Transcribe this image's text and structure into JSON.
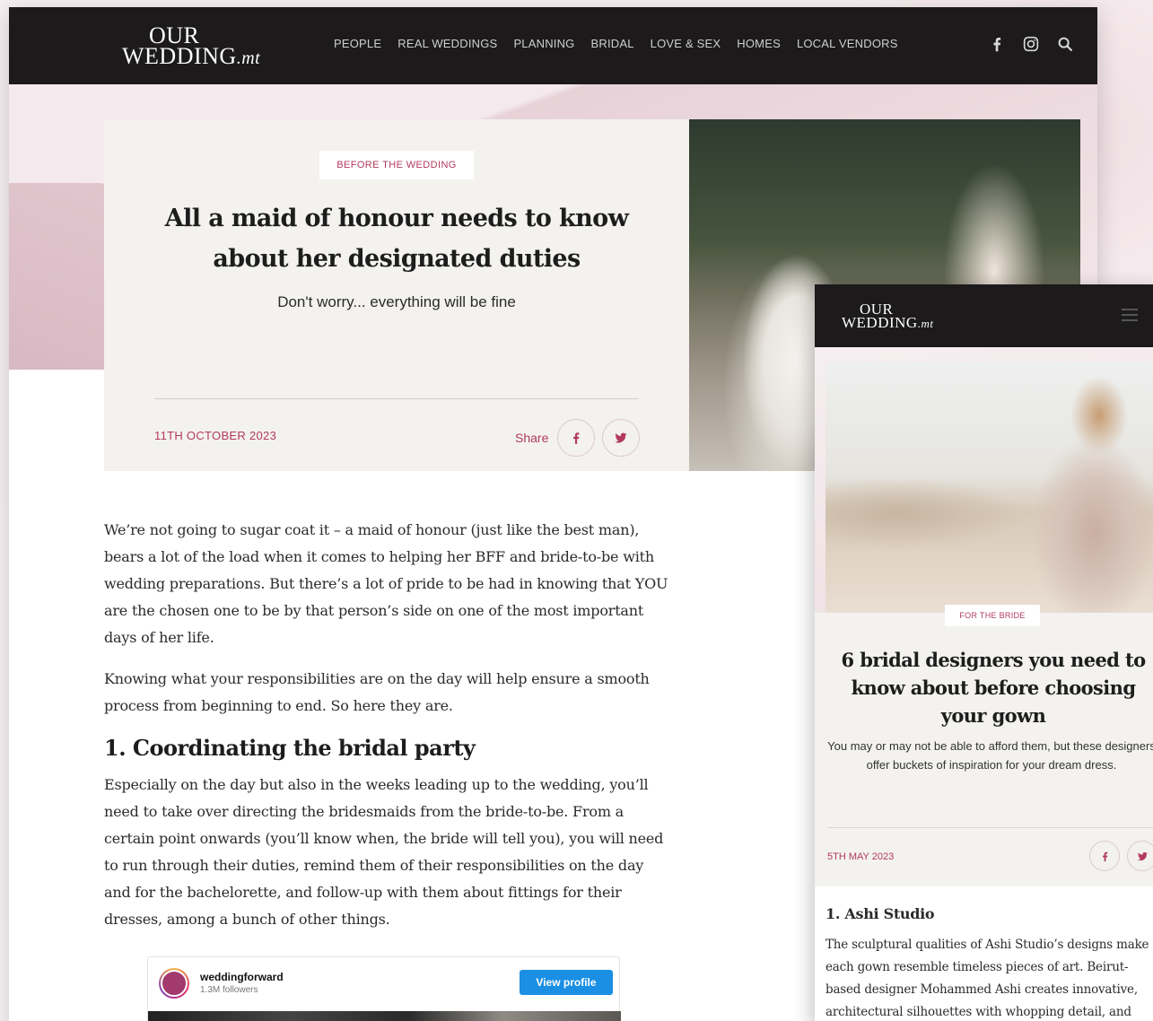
{
  "desktop": {
    "nav": {
      "logo_line1": "OUR",
      "logo_line2": "WEDDING",
      "logo_suffix": ".mt",
      "items": [
        "PEOPLE",
        "REAL WEDDINGS",
        "PLANNING",
        "BRIDAL",
        "LOVE & SEX",
        "HOMES",
        "LOCAL VENDORS"
      ],
      "icons": [
        "facebook-icon",
        "instagram-icon",
        "search-icon"
      ]
    },
    "hero": {
      "category": "BEFORE THE WEDDING",
      "title": "All a maid of honour needs to know about her designated duties",
      "subtitle": "Don't worry... everything will be fine",
      "date": "11TH OCTOBER 2023",
      "share_label": "Share"
    },
    "article": {
      "p1": "We’re not going to sugar coat it – a maid of honour (just like the best man), bears a lot of the load when it comes to helping her BFF and bride-to-be with wedding preparations. But there’s a lot of pride to be had in knowing that YOU are the chosen one to be by that person’s side on one of the most important days of her life.",
      "p2": "Knowing what your responsibilities are on the day will help ensure a smooth process from beginning to end. So here they are.",
      "h2": "1. Coordinating the bridal party",
      "p3": "Especially on the day but also in the weeks leading up to the wedding, you’ll need to take over directing the bridesmaids from the bride-to-be. From a certain point onwards (you’ll know when, the bride will tell you), you will need to run through their duties, remind them of their responsibilities on the day and for the bachelorette, and follow-up with them about fittings for their dresses, among a bunch of other things."
    },
    "instagram": {
      "username": "weddingforward",
      "followers": "1.3M followers",
      "button": "View profile"
    }
  },
  "mobile": {
    "nav": {
      "logo_line1": "OUR",
      "logo_line2": "WEDDING",
      "logo_suffix": ".mt"
    },
    "hero": {
      "category": "FOR THE BRIDE",
      "title": "6 bridal designers you need to know about before choosing your gown",
      "subtitle": "You may or may not be able to afford them, but these designers offer buckets of inspiration for your dream dress.",
      "date": "5TH MAY 2023"
    },
    "article": {
      "h3": "1. Ashi Studio",
      "lines": [
        "The sculptural qualities of Ashi Studio’s designs make",
        "each gown resemble timeless pieces of art. Beirut-",
        "based designer Mohammed Ashi creates innovative,",
        "architectural silhouettes with whopping detail, and"
      ]
    }
  },
  "colors": {
    "accent": "#b23a5e",
    "nav_bg": "#1c1a1b",
    "card_bg": "#f3f2ef",
    "instagram_button": "#1a8fe3"
  }
}
